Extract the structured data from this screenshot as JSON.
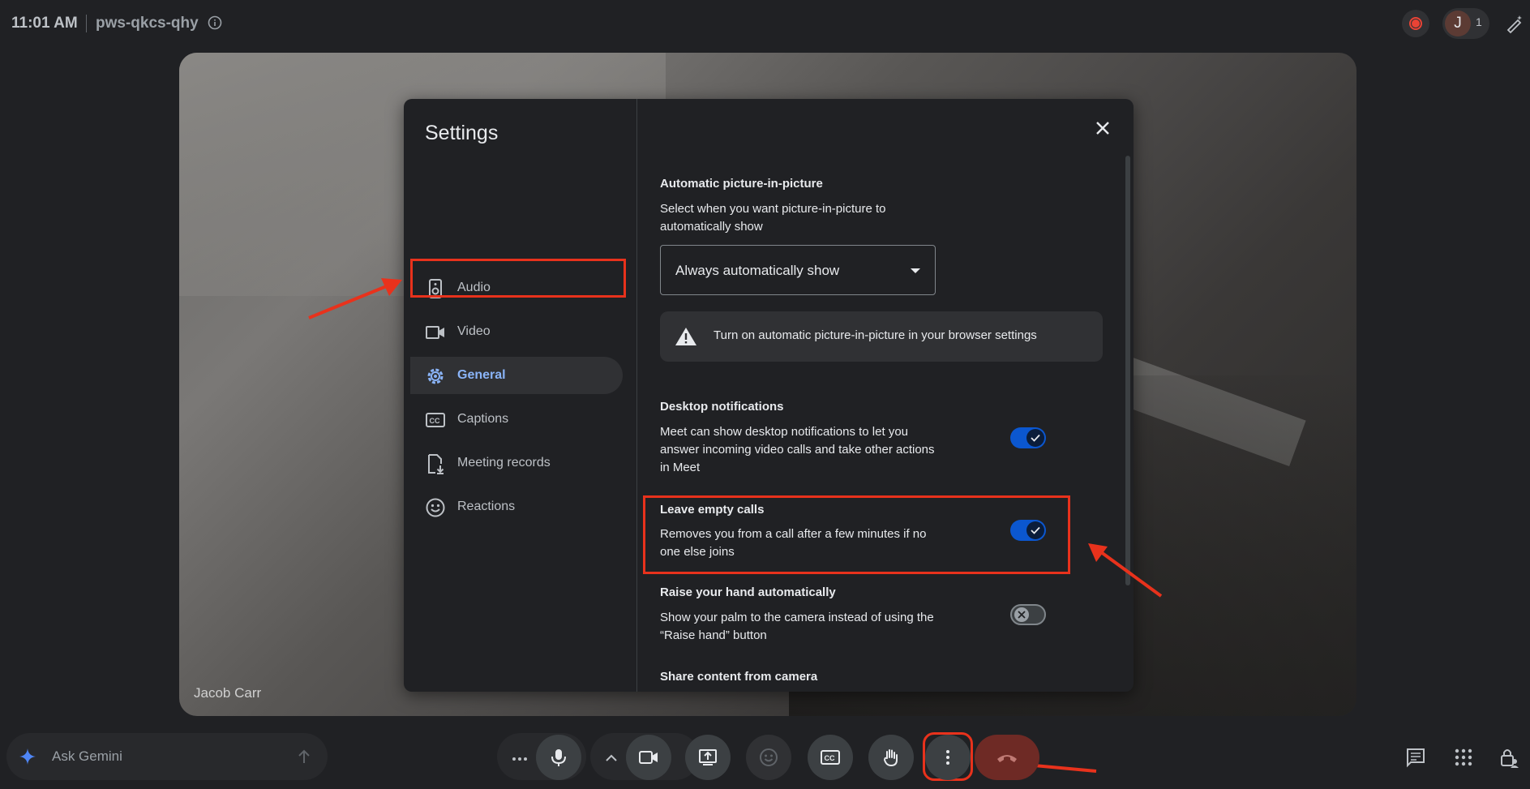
{
  "topbar": {
    "time": "11:01 AM",
    "meeting_code": "pws-qkcs-qhy",
    "avatar_initial": "J",
    "participant_count": "1"
  },
  "video": {
    "participant_name": "Jacob Carr"
  },
  "settings": {
    "title": "Settings",
    "nav": [
      {
        "label": "Audio",
        "icon": "speaker-icon"
      },
      {
        "label": "Video",
        "icon": "video-camera-icon"
      },
      {
        "label": "General",
        "icon": "gear-icon",
        "active": true
      },
      {
        "label": "Captions",
        "icon": "captions-icon"
      },
      {
        "label": "Meeting records",
        "icon": "file-download-icon"
      },
      {
        "label": "Reactions",
        "icon": "smiley-icon"
      }
    ],
    "pip": {
      "title": "Automatic picture-in-picture",
      "desc": "Select when you want picture-in-picture to automatically show",
      "selected": "Always automatically show",
      "banner": "Turn on automatic picture-in-picture in your browser settings"
    },
    "desktop_notifications": {
      "title": "Desktop notifications",
      "desc": "Meet can show desktop notifications to let you answer incoming video calls and take other actions in Meet",
      "enabled": true
    },
    "leave_empty_calls": {
      "title": "Leave empty calls",
      "desc": "Removes you from a call after a few minutes if no one else joins",
      "enabled": true
    },
    "raise_hand": {
      "title": "Raise your hand automatically",
      "desc": "Show your palm to the camera instead of using the “Raise hand” button",
      "enabled": false
    },
    "share_camera": {
      "title": "Share content from camera"
    }
  },
  "bottombar": {
    "gemini_label": "Ask Gemini"
  },
  "colors": {
    "accent": "#8ab4f8",
    "toggle_on": "#0b57d0",
    "highlight": "#e8321c",
    "background": "#202124"
  }
}
